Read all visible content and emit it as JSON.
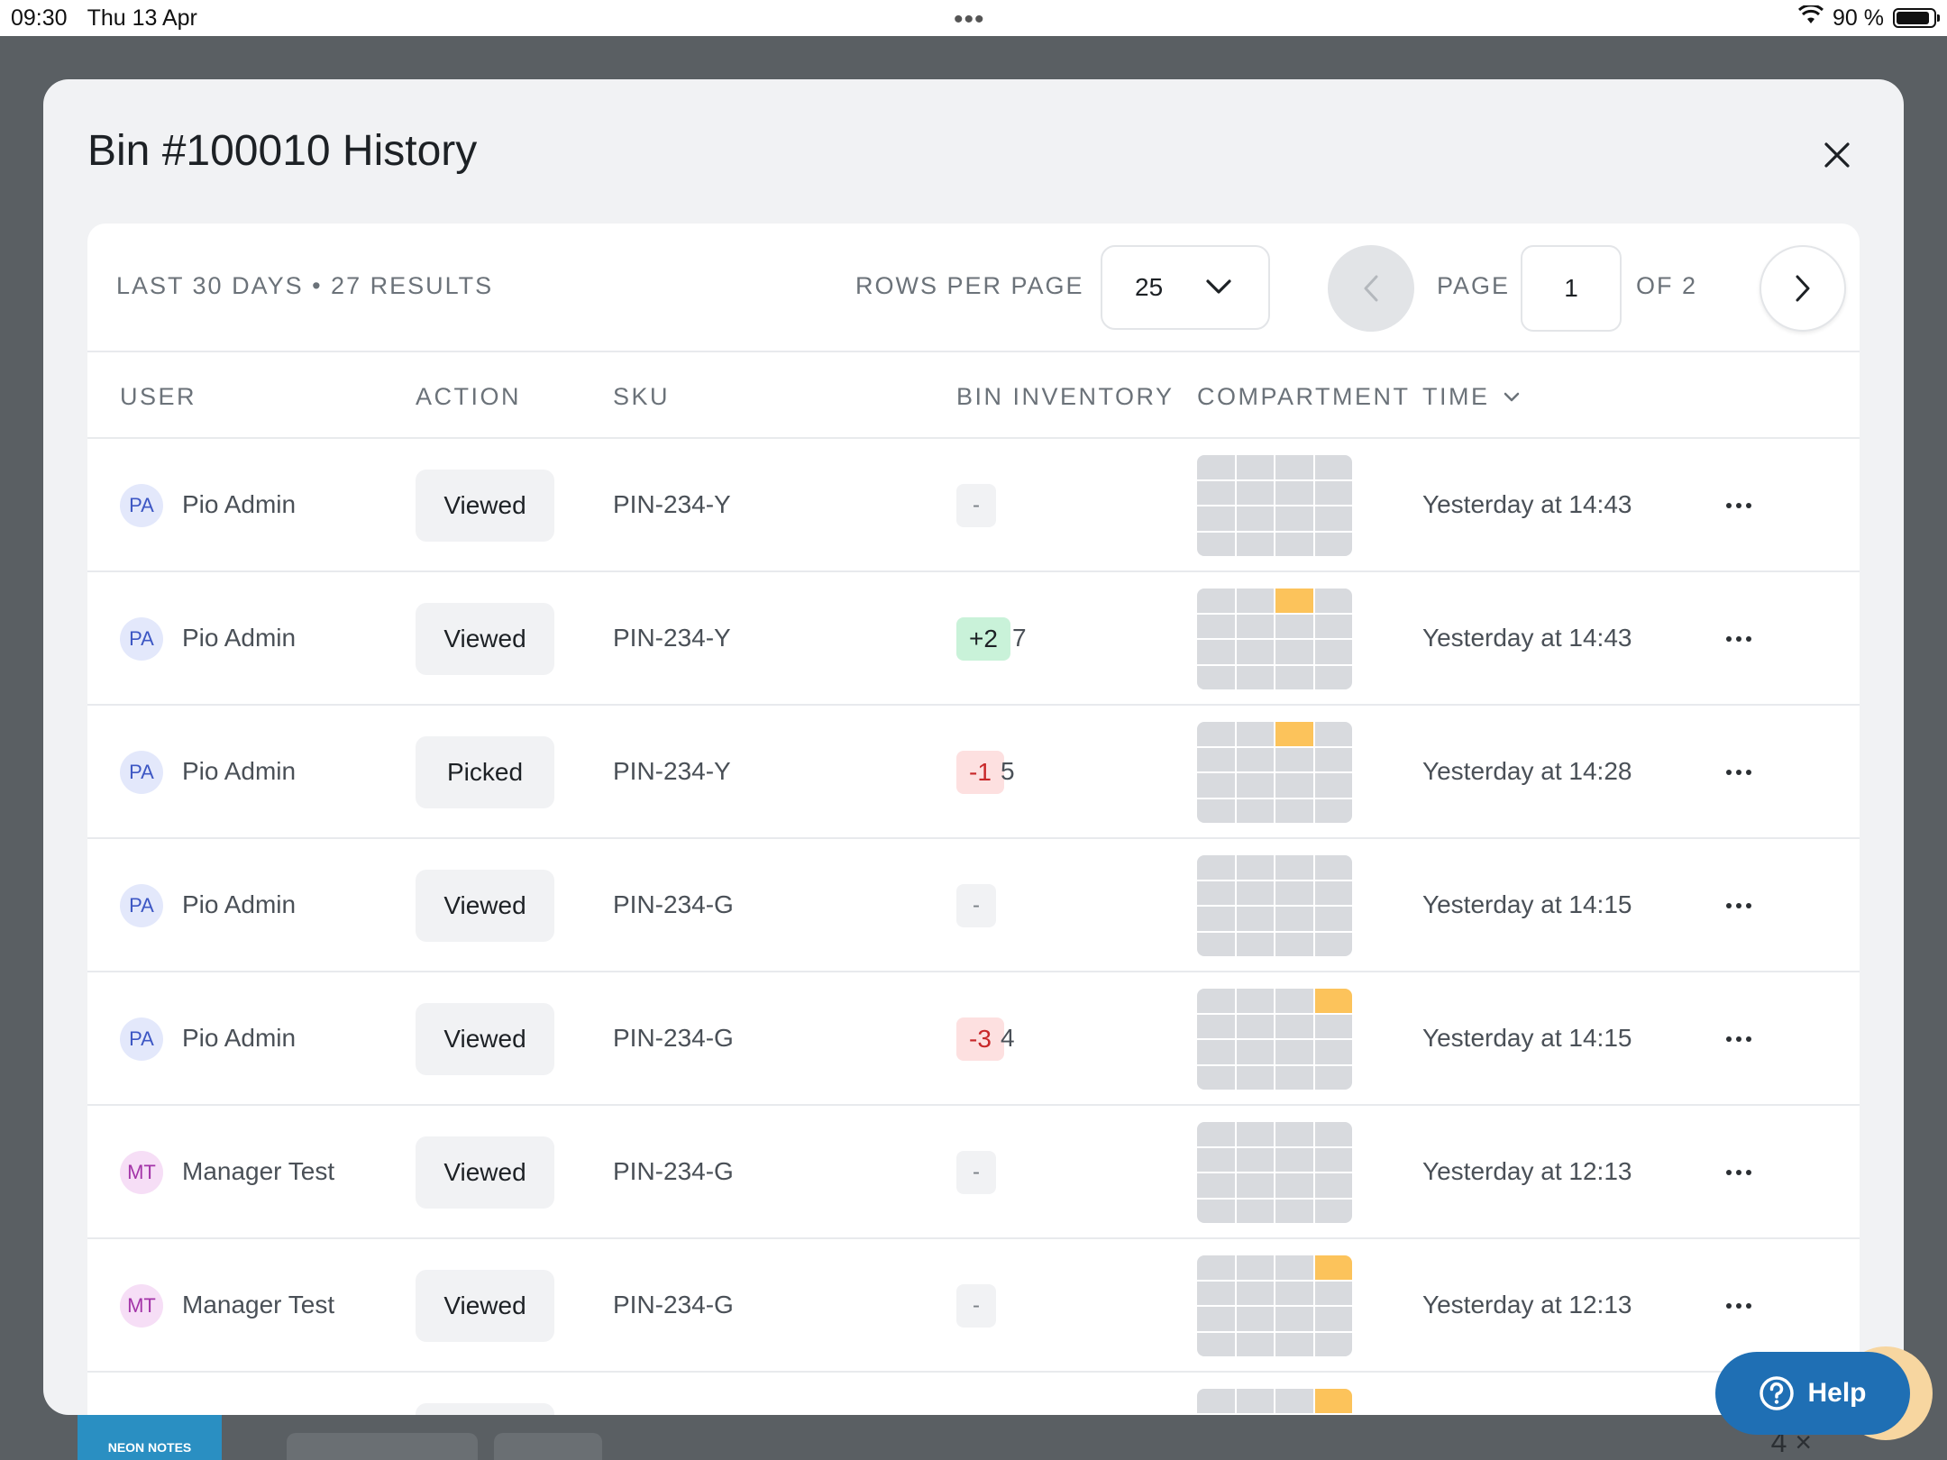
{
  "status_bar": {
    "time": "09:30",
    "date": "Thu 13 Apr",
    "battery": "90 %"
  },
  "background": {
    "logo_text": "NEON NOTES",
    "count": "4 ×"
  },
  "modal": {
    "title": "Bin #100010 History",
    "summary": "LAST 30 DAYS • 27 RESULTS",
    "rows_per_page_label": "ROWS PER PAGE",
    "rows_per_page_value": "25",
    "page_label": "PAGE",
    "page_value": "1",
    "of_label": "OF 2"
  },
  "table": {
    "headers": {
      "user": "USER",
      "action": "ACTION",
      "sku": "SKU",
      "bin_inventory": "BIN INVENTORY",
      "compartment": "COMPARTMENT",
      "time": "TIME"
    },
    "rows": [
      {
        "initials": "PA",
        "user": "Pio Admin",
        "action": "Viewed",
        "sku": "PIN-234-Y",
        "delta": "-",
        "delta_type": "none",
        "qty": "",
        "highlight": [],
        "time": "Yesterday at 14:43"
      },
      {
        "initials": "PA",
        "user": "Pio Admin",
        "action": "Viewed",
        "sku": "PIN-234-Y",
        "delta": "+2",
        "delta_type": "pos",
        "qty": "7",
        "highlight": [
          [
            0,
            2
          ]
        ],
        "time": "Yesterday at 14:43"
      },
      {
        "initials": "PA",
        "user": "Pio Admin",
        "action": "Picked",
        "sku": "PIN-234-Y",
        "delta": "-1",
        "delta_type": "neg",
        "qty": "5",
        "highlight": [
          [
            0,
            2
          ]
        ],
        "time": "Yesterday at 14:28"
      },
      {
        "initials": "PA",
        "user": "Pio Admin",
        "action": "Viewed",
        "sku": "PIN-234-G",
        "delta": "-",
        "delta_type": "none",
        "qty": "",
        "highlight": [],
        "time": "Yesterday at 14:15"
      },
      {
        "initials": "PA",
        "user": "Pio Admin",
        "action": "Viewed",
        "sku": "PIN-234-G",
        "delta": "-3",
        "delta_type": "neg",
        "qty": "4",
        "highlight": [
          [
            0,
            3
          ]
        ],
        "time": "Yesterday at 14:15"
      },
      {
        "initials": "MT",
        "user": "Manager Test",
        "action": "Viewed",
        "sku": "PIN-234-G",
        "delta": "-",
        "delta_type": "none",
        "qty": "",
        "highlight": [],
        "time": "Yesterday at 12:13"
      },
      {
        "initials": "MT",
        "user": "Manager Test",
        "action": "Viewed",
        "sku": "PIN-234-G",
        "delta": "-",
        "delta_type": "none",
        "qty": "",
        "highlight": [
          [
            0,
            3
          ]
        ],
        "time": "Yesterday at 12:13"
      },
      {
        "initials": "",
        "user": "",
        "action": "",
        "sku": "",
        "delta": "",
        "delta_type": "empty",
        "qty": "",
        "highlight": [
          [
            0,
            3
          ]
        ],
        "time": ""
      }
    ]
  },
  "help": {
    "label": "Help"
  },
  "colors": {
    "accent_blue": "#1f6fb4",
    "highlight_yellow": "#fcc35b",
    "positive_bg": "#c9f2d9",
    "negative_bg": "#fde0e0"
  }
}
